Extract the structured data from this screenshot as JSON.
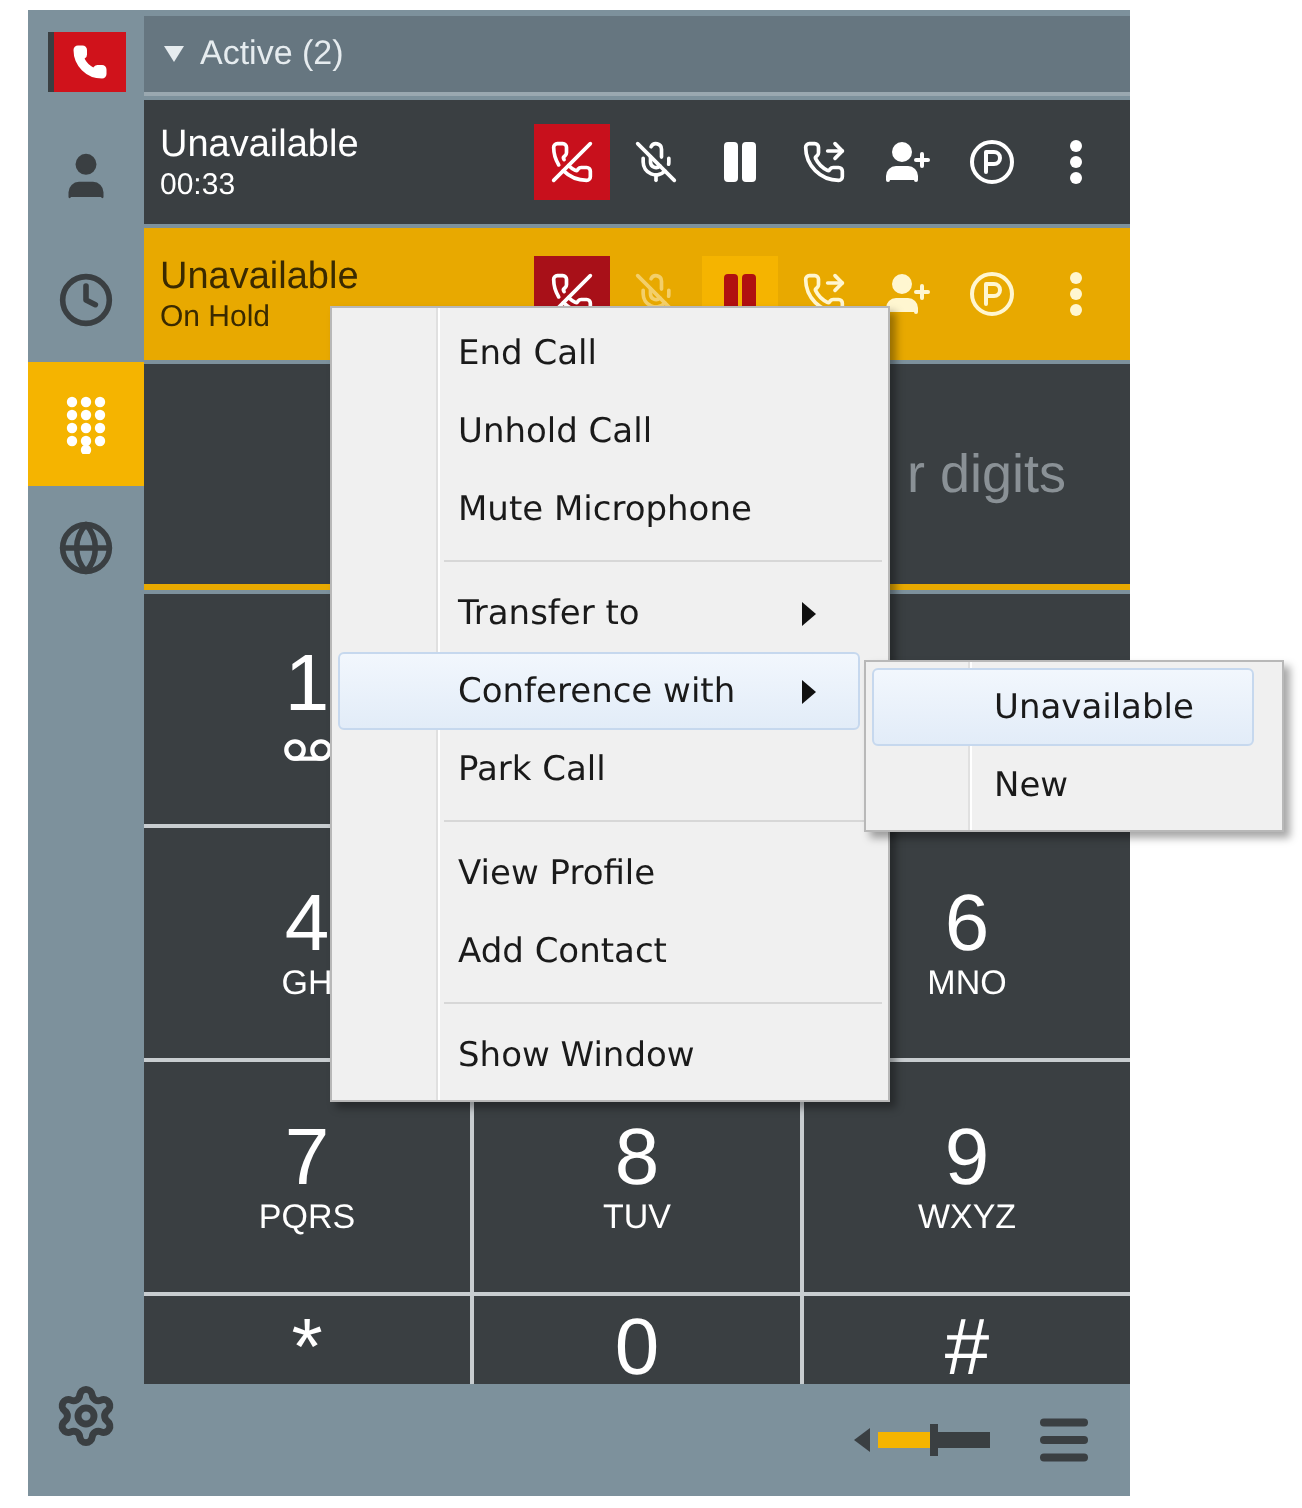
{
  "sidebar": {
    "items": [
      {
        "kind": "contacts",
        "selected": false
      },
      {
        "kind": "history",
        "selected": false
      },
      {
        "kind": "dialpad",
        "selected": true
      },
      {
        "kind": "globe",
        "selected": false
      }
    ]
  },
  "call_group": {
    "title": "Active (2)",
    "expanded": true
  },
  "calls": [
    {
      "name": "Unavailable",
      "detail": "00:33",
      "on_hold": false
    },
    {
      "name": "Unavailable",
      "detail": "On Hold",
      "on_hold": true
    }
  ],
  "dial_field": {
    "placeholder": "r digits"
  },
  "keypad": {
    "rows": [
      {
        "left": {
          "digit": "1",
          "voicemail": true
        }
      },
      {
        "left": {
          "digit": "4",
          "letters": "GH"
        },
        "right": {
          "digit": "6",
          "letters": "MNO"
        }
      },
      {
        "left": {
          "digit": "7",
          "letters": "PQRS"
        },
        "middle": {
          "digit": "8",
          "letters": "TUV"
        },
        "right": {
          "digit": "9",
          "letters": "WXYZ"
        }
      },
      {
        "left": {
          "digit": "*"
        },
        "middle": {
          "digit": "0"
        },
        "right": {
          "digit": "#"
        }
      }
    ]
  },
  "volume": {
    "level": 0.5
  },
  "context_menu": {
    "groups": [
      [
        {
          "label": "End Call",
          "submenu": false,
          "selected": false
        },
        {
          "label": "Unhold Call",
          "submenu": false,
          "selected": false
        },
        {
          "label": "Mute Microphone",
          "submenu": false,
          "selected": false
        }
      ],
      [
        {
          "label": "Transfer to",
          "submenu": true,
          "selected": false
        },
        {
          "label": "Conference with",
          "submenu": true,
          "selected": true
        },
        {
          "label": "Park Call",
          "submenu": false,
          "selected": false
        }
      ],
      [
        {
          "label": "View Profile",
          "submenu": false,
          "selected": false
        },
        {
          "label": "Add Contact",
          "submenu": false,
          "selected": false
        }
      ],
      [
        {
          "label": "Show Window",
          "submenu": false,
          "selected": false
        }
      ]
    ]
  },
  "submenu": {
    "items": [
      {
        "label": "Unavailable",
        "selected": true
      },
      {
        "label": "New",
        "selected": false
      }
    ]
  }
}
